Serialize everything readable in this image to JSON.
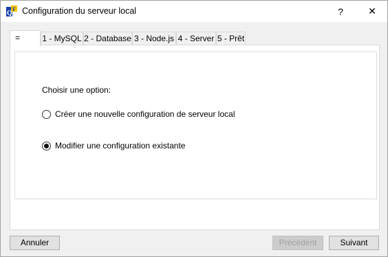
{
  "window": {
    "title": "Configuration du serveur local",
    "help_label": "?",
    "close_label": "✕"
  },
  "tabs": [
    {
      "label": "=",
      "active": true
    },
    {
      "label": "1 - MySQL",
      "active": false
    },
    {
      "label": "2 - Database",
      "active": false
    },
    {
      "label": "3 - Node.js",
      "active": false
    },
    {
      "label": "4 - Server",
      "active": false
    },
    {
      "label": "5 - Prêt",
      "active": false
    }
  ],
  "panel": {
    "prompt": "Choisir une option:",
    "options": [
      {
        "label": "Créer une nouvelle configuration de serveur local",
        "selected": false
      },
      {
        "label": "Modifier une configuration existante",
        "selected": true
      }
    ]
  },
  "buttons": {
    "cancel": "Annuler",
    "previous": "Précédent",
    "next": "Suivant"
  }
}
